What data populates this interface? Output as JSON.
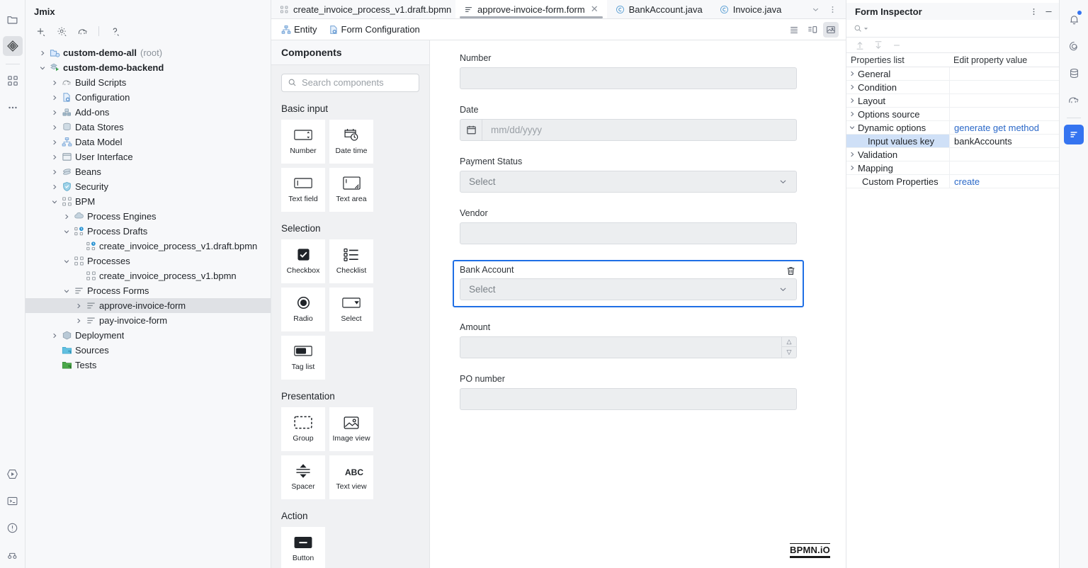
{
  "left_rail": {
    "items": [
      {
        "name": "project-folder-icon",
        "icon": "folder"
      },
      {
        "name": "jmix-icon",
        "icon": "jmix",
        "active": true
      },
      {
        "name": "structure-icon",
        "icon": "grid"
      },
      {
        "name": "more-icon",
        "icon": "dots"
      }
    ],
    "bottom_items": [
      {
        "name": "run-icon",
        "icon": "run"
      },
      {
        "name": "terminal-icon",
        "icon": "terminal"
      },
      {
        "name": "problems-icon",
        "icon": "problems"
      },
      {
        "name": "version-control-icon",
        "icon": "vcs"
      }
    ]
  },
  "project": {
    "title": "Jmix",
    "toolbar": [
      "add-icon",
      "settings-icon",
      "elephant-gradle-icon",
      "help-icon"
    ],
    "tree": [
      {
        "depth": 0,
        "twisty": "collapsed",
        "icon": "module-root",
        "label": "custom-demo-all",
        "sub": "(root)",
        "bold": true
      },
      {
        "depth": 0,
        "twisty": "expanded",
        "icon": "module-run",
        "label": "custom-demo-backend",
        "sub": "",
        "bold": true
      },
      {
        "depth": 1,
        "twisty": "collapsed",
        "icon": "gradle",
        "label": "Build Scripts",
        "sub": "",
        "bold": false
      },
      {
        "depth": 1,
        "twisty": "collapsed",
        "icon": "config",
        "label": "Configuration",
        "sub": "",
        "bold": false
      },
      {
        "depth": 1,
        "twisty": "collapsed",
        "icon": "addons",
        "label": "Add-ons",
        "sub": "",
        "bold": false
      },
      {
        "depth": 1,
        "twisty": "collapsed",
        "icon": "datastore",
        "label": "Data Stores",
        "sub": "",
        "bold": false
      },
      {
        "depth": 1,
        "twisty": "collapsed",
        "icon": "datamodel",
        "label": "Data Model",
        "sub": "",
        "bold": false
      },
      {
        "depth": 1,
        "twisty": "collapsed",
        "icon": "ui",
        "label": "User Interface",
        "sub": "",
        "bold": false
      },
      {
        "depth": 1,
        "twisty": "collapsed",
        "icon": "beans",
        "label": "Beans",
        "sub": "",
        "bold": false
      },
      {
        "depth": 1,
        "twisty": "collapsed",
        "icon": "security",
        "label": "Security",
        "sub": "",
        "bold": false
      },
      {
        "depth": 1,
        "twisty": "expanded",
        "icon": "bpm",
        "label": "BPM",
        "sub": "",
        "bold": false
      },
      {
        "depth": 2,
        "twisty": "collapsed",
        "icon": "engine",
        "label": "Process Engines",
        "sub": "",
        "bold": false
      },
      {
        "depth": 2,
        "twisty": "expanded",
        "icon": "draft",
        "label": "Process Drafts",
        "sub": "",
        "bold": false
      },
      {
        "depth": 3,
        "twisty": "none",
        "icon": "draft",
        "label": "create_invoice_process_v1.draft.bpmn",
        "sub": "",
        "bold": false
      },
      {
        "depth": 2,
        "twisty": "expanded",
        "icon": "bpm",
        "label": "Processes",
        "sub": "",
        "bold": false
      },
      {
        "depth": 3,
        "twisty": "none",
        "icon": "bpm",
        "label": "create_invoice_process_v1.bpmn",
        "sub": "",
        "bold": false
      },
      {
        "depth": 2,
        "twisty": "expanded",
        "icon": "form",
        "label": "Process Forms",
        "sub": "",
        "bold": false
      },
      {
        "depth": 3,
        "twisty": "collapsed",
        "icon": "form",
        "label": "approve-invoice-form",
        "sub": "",
        "bold": false,
        "selected": true
      },
      {
        "depth": 3,
        "twisty": "collapsed",
        "icon": "form",
        "label": "pay-invoice-form",
        "sub": "",
        "bold": false
      },
      {
        "depth": 1,
        "twisty": "collapsed",
        "icon": "deployment",
        "label": "Deployment",
        "sub": "",
        "bold": false
      },
      {
        "depth": 1,
        "twisty": "none",
        "icon": "sources",
        "label": "Sources",
        "sub": "",
        "bold": false
      },
      {
        "depth": 1,
        "twisty": "none",
        "icon": "tests",
        "label": "Tests",
        "sub": "",
        "bold": false
      }
    ]
  },
  "tabs": [
    {
      "label": "create_invoice_process_v1.draft.bpmn",
      "icon": "bpmn",
      "active": false,
      "closable": false
    },
    {
      "label": "approve-invoice-form.form",
      "icon": "form",
      "active": true,
      "closable": true
    },
    {
      "label": "BankAccount.java",
      "icon": "java-class",
      "active": false,
      "closable": false
    },
    {
      "label": "Invoice.java",
      "icon": "java-class",
      "active": false,
      "closable": false
    }
  ],
  "tabbar_right": [
    "chevron-down-icon",
    "more-vertical-icon"
  ],
  "subbar": {
    "items": [
      {
        "label": "Entity",
        "icon": "entity-icon"
      },
      {
        "label": "Form Configuration",
        "icon": "form-config-icon"
      }
    ],
    "view_modes": [
      {
        "name": "list-view-icon",
        "active": false
      },
      {
        "name": "split-view-icon",
        "active": false
      },
      {
        "name": "design-view-icon",
        "active": true
      }
    ]
  },
  "palette": {
    "title": "Components",
    "search_placeholder": "Search components",
    "groups": [
      {
        "title": "Basic input",
        "items": [
          {
            "label": "Number",
            "icon": "number-stepper-icon"
          },
          {
            "label": "Date time",
            "icon": "calendar-clock-icon"
          },
          {
            "label": "Text field",
            "icon": "text-field-icon"
          },
          {
            "label": "Text area",
            "icon": "text-area-icon"
          }
        ]
      },
      {
        "title": "Selection",
        "items": [
          {
            "label": "Checkbox",
            "icon": "checkbox-icon"
          },
          {
            "label": "Checklist",
            "icon": "checklist-icon"
          },
          {
            "label": "Radio",
            "icon": "radio-icon"
          },
          {
            "label": "Select",
            "icon": "select-dropdown-icon"
          },
          {
            "label": "Tag list",
            "icon": "tag-list-icon"
          }
        ]
      },
      {
        "title": "Presentation",
        "items": [
          {
            "label": "Group",
            "icon": "group-icon"
          },
          {
            "label": "Image view",
            "icon": "image-icon"
          },
          {
            "label": "Spacer",
            "icon": "spacer-icon"
          },
          {
            "label": "Text view",
            "icon": "abc-icon"
          }
        ]
      },
      {
        "title": "Action",
        "items": [
          {
            "label": "Button",
            "icon": "button-icon"
          }
        ]
      }
    ]
  },
  "canvas": {
    "fields": [
      {
        "label": "Number",
        "type": "text",
        "value": "",
        "placeholder": "",
        "selected": false
      },
      {
        "label": "Date",
        "type": "date",
        "value": "",
        "placeholder": "mm/dd/yyyy",
        "selected": false
      },
      {
        "label": "Payment Status",
        "type": "select",
        "value": "Select",
        "placeholder": "",
        "selected": false
      },
      {
        "label": "Vendor",
        "type": "text",
        "value": "",
        "placeholder": "",
        "selected": false
      },
      {
        "label": "Bank Account",
        "type": "select",
        "value": "Select",
        "placeholder": "",
        "selected": true
      },
      {
        "label": "Amount",
        "type": "stepper",
        "value": "",
        "placeholder": "",
        "selected": false
      },
      {
        "label": "PO number",
        "type": "text",
        "value": "",
        "placeholder": "",
        "selected": false
      }
    ],
    "watermark": "BPMN.iO",
    "delete_icon": "trash-icon",
    "selection_color": "#1f6fe5"
  },
  "inspector": {
    "title": "Form Inspector",
    "head_actions": [
      "more-vertical-icon",
      "minimize-icon"
    ],
    "search_icon": "search-icon",
    "tools": [
      "expand-all-icon",
      "collapse-all-icon",
      "remove-icon"
    ],
    "columns": {
      "name": "Properties list",
      "value": "Edit property value"
    },
    "rows": [
      {
        "twisty": "collapsed",
        "name": "General",
        "value": "",
        "link": false,
        "child": false,
        "selected": false
      },
      {
        "twisty": "collapsed",
        "name": "Condition",
        "value": "",
        "link": false,
        "child": false,
        "selected": false
      },
      {
        "twisty": "collapsed",
        "name": "Layout",
        "value": "",
        "link": false,
        "child": false,
        "selected": false
      },
      {
        "twisty": "collapsed",
        "name": "Options source",
        "value": "",
        "link": false,
        "child": false,
        "selected": false
      },
      {
        "twisty": "expanded",
        "name": "Dynamic options",
        "value": "generate get method",
        "link": true,
        "child": false,
        "selected": false
      },
      {
        "twisty": "none",
        "name": "Input values key",
        "value": "bankAccounts",
        "link": false,
        "child": true,
        "selected": true
      },
      {
        "twisty": "collapsed",
        "name": "Validation",
        "value": "",
        "link": false,
        "child": false,
        "selected": false
      },
      {
        "twisty": "collapsed",
        "name": "Mapping",
        "value": "",
        "link": false,
        "child": false,
        "selected": false
      },
      {
        "twisty": "none",
        "name": "Custom Properties",
        "value": "create",
        "link": true,
        "child": false,
        "selected": false
      }
    ]
  },
  "right_rail": {
    "items": [
      {
        "name": "notifications-icon",
        "icon": "bell",
        "badge": true,
        "active": false
      },
      {
        "name": "jmix-studio-icon",
        "icon": "spiral",
        "badge": false,
        "active": false
      },
      {
        "name": "database-icon",
        "icon": "db",
        "badge": false,
        "active": false
      },
      {
        "name": "gradle-icon",
        "icon": "elephant",
        "badge": false,
        "active": false
      },
      {
        "name": "form-inspector-icon",
        "icon": "inspector",
        "badge": false,
        "active": true
      }
    ]
  }
}
